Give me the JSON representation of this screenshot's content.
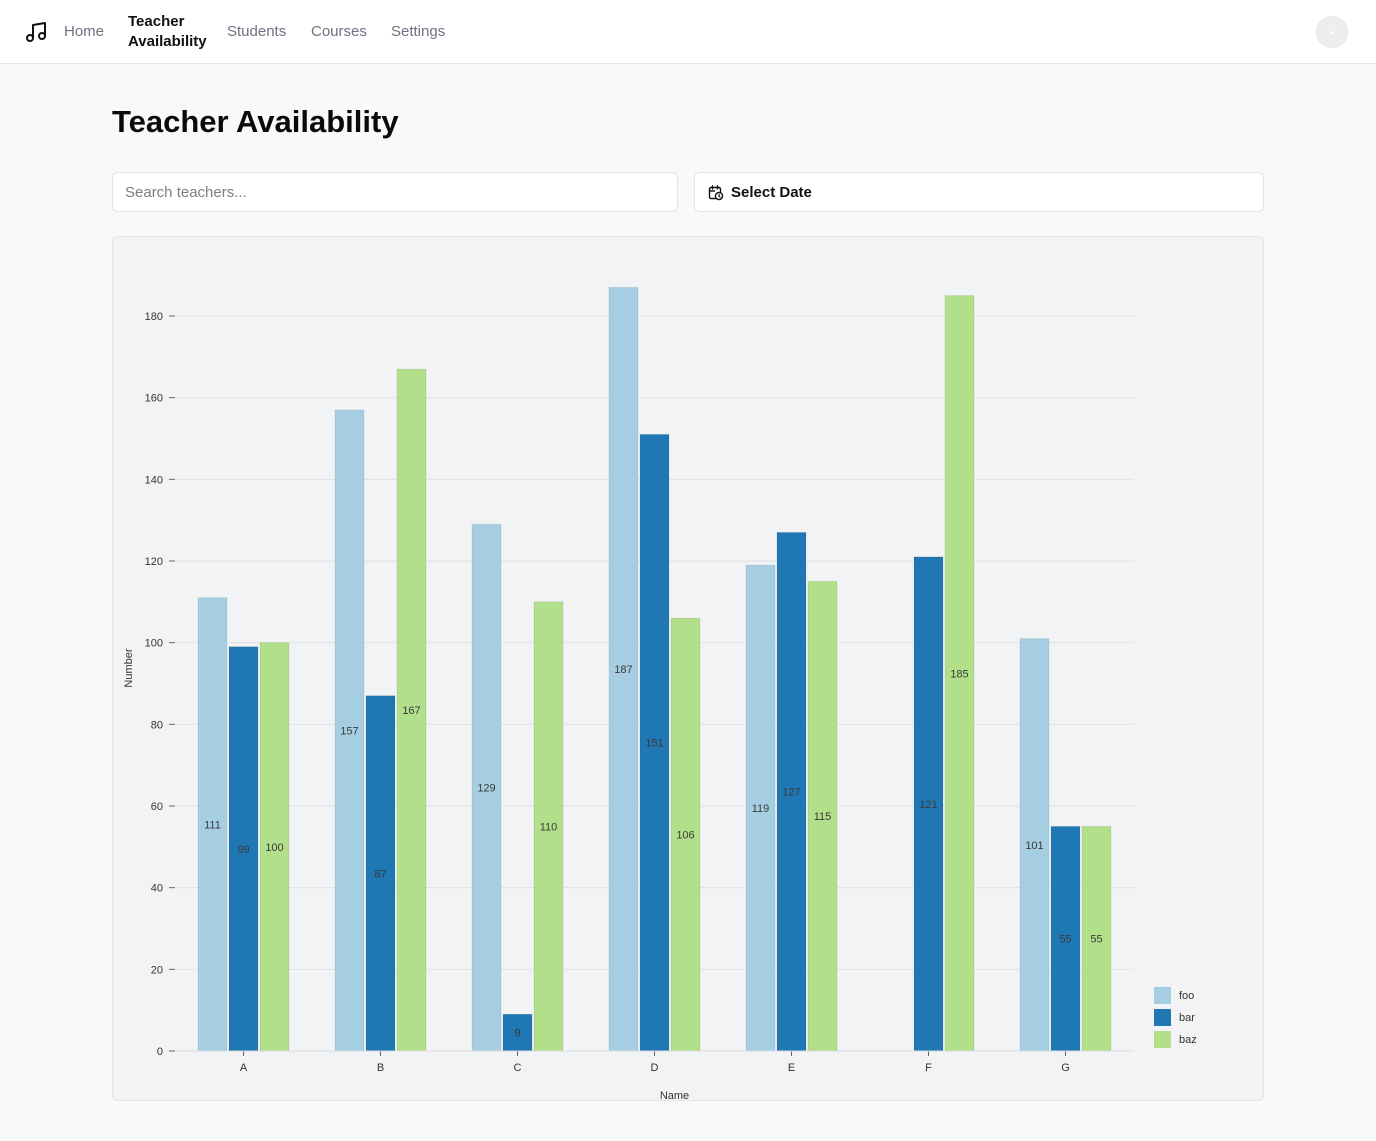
{
  "nav": {
    "logo_icon": "music-note-icon",
    "links": [
      {
        "label": "Home",
        "active": false
      },
      {
        "label": "Teacher\nAvailability",
        "active": true
      },
      {
        "label": "Students",
        "active": false
      },
      {
        "label": "Courses",
        "active": false
      },
      {
        "label": "Settings",
        "active": false
      }
    ],
    "avatar_icon": "user-avatar"
  },
  "page": {
    "title": "Teacher Availability"
  },
  "filters": {
    "search_placeholder": "Search teachers...",
    "search_value": "",
    "date_button_label": "Select Date",
    "date_icon": "calendar-clock-icon"
  },
  "chart_data": {
    "type": "bar",
    "categories": [
      "A",
      "B",
      "C",
      "D",
      "E",
      "F",
      "G"
    ],
    "series": [
      {
        "name": "foo",
        "color": "#a6cee3",
        "values": [
          111,
          157,
          129,
          187,
          119,
          0,
          101
        ]
      },
      {
        "name": "bar",
        "color": "#1f78b4",
        "values": [
          99,
          87,
          9,
          151,
          127,
          121,
          55
        ]
      },
      {
        "name": "baz",
        "color": "#b2df8a",
        "values": [
          100,
          167,
          110,
          106,
          115,
          185,
          55
        ]
      }
    ],
    "xlabel": "Name",
    "ylabel": "Number",
    "ylim": [
      0,
      180
    ],
    "yticks": [
      0,
      20,
      40,
      60,
      80,
      100,
      120,
      140,
      160,
      180
    ],
    "grid": true,
    "legend": "bottom-right",
    "show_data_labels": true
  }
}
